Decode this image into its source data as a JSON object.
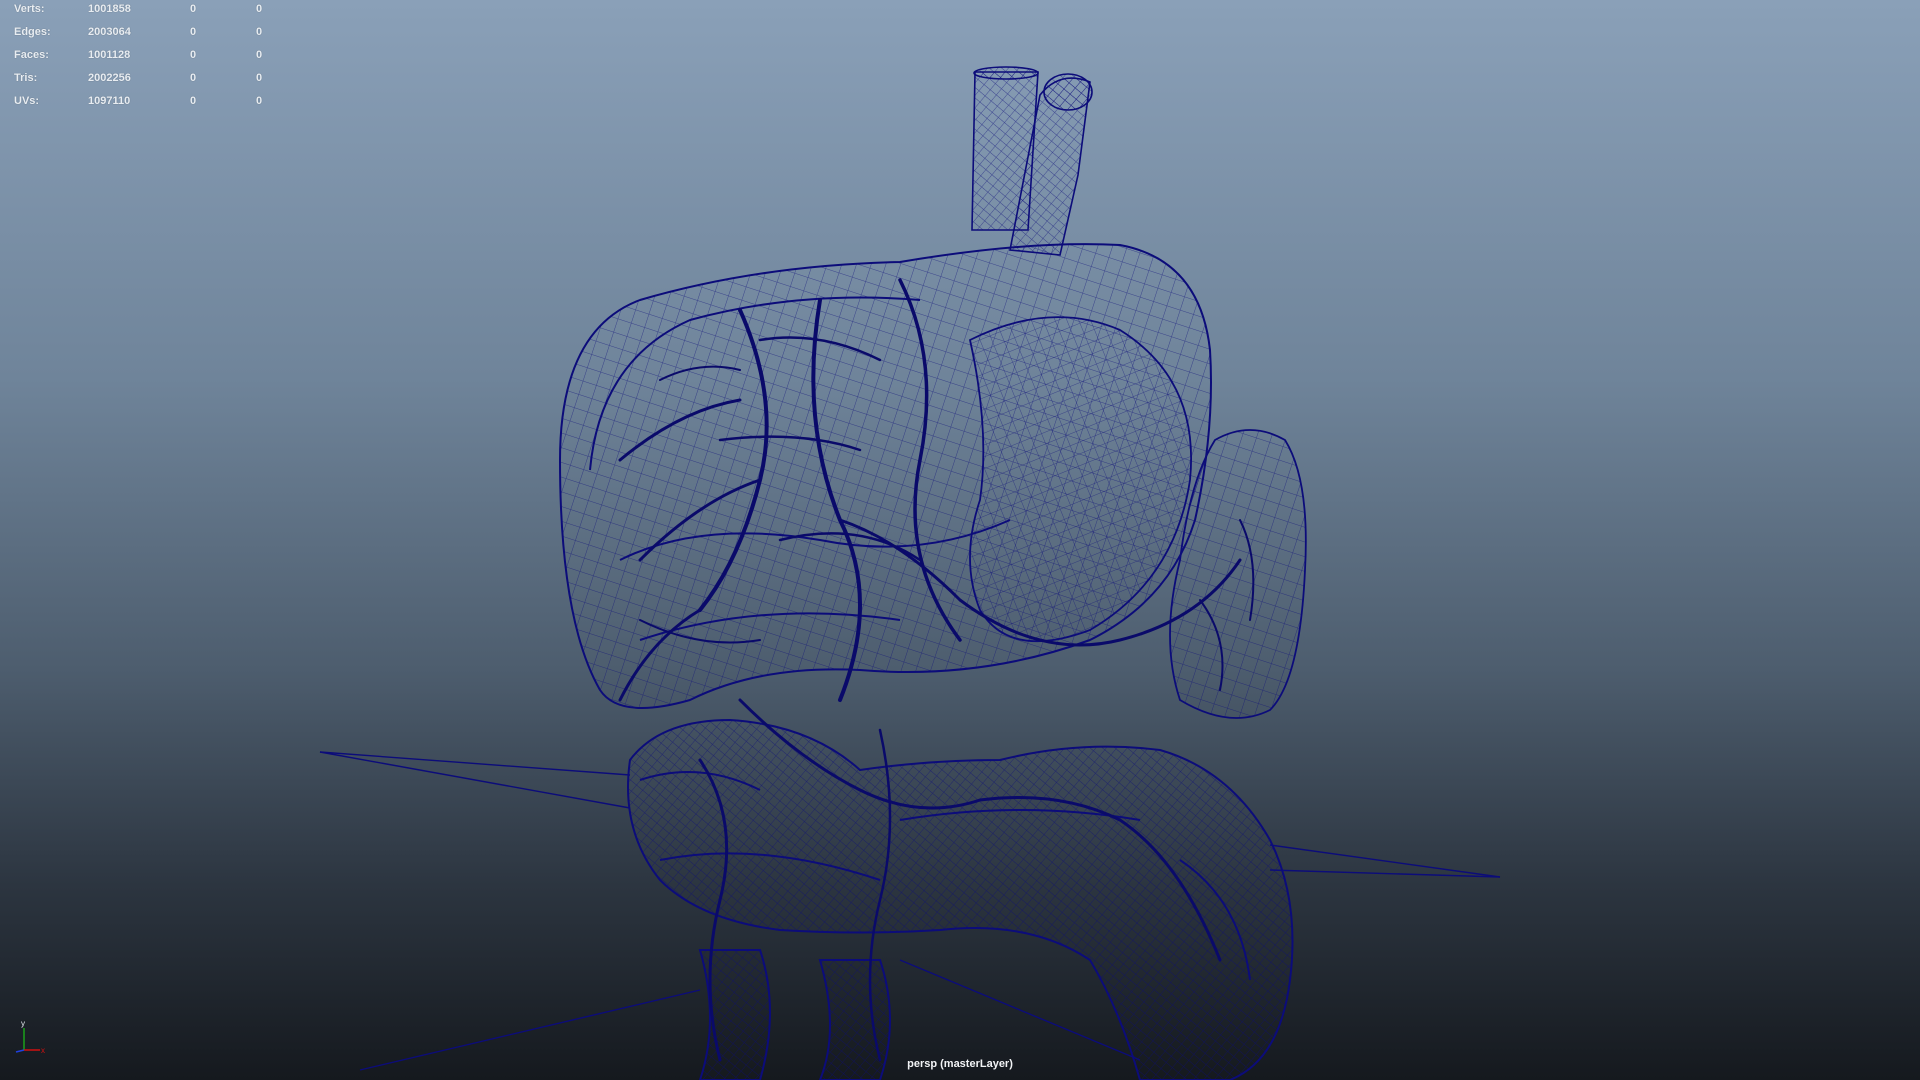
{
  "viewport": {
    "camera_label": "persp (masterLayer)",
    "wire_color": "#0c0c7a",
    "background_top": "#8aa0b8",
    "background_bottom": "#15191e"
  },
  "hud": {
    "rows": [
      {
        "label": "Verts:",
        "v1": "1001858",
        "v2": "0",
        "v3": "0"
      },
      {
        "label": "Edges:",
        "v1": "2003064",
        "v2": "0",
        "v3": "0"
      },
      {
        "label": "Faces:",
        "v1": "1001128",
        "v2": "0",
        "v3": "0"
      },
      {
        "label": "Tris:",
        "v1": "2002256",
        "v2": "0",
        "v3": "0"
      },
      {
        "label": "UVs:",
        "v1": "1097110",
        "v2": "0",
        "v3": "0"
      }
    ]
  },
  "axis_gizmo": {
    "y_label": "y",
    "x_label": "x",
    "colors": {
      "x": "#d01010",
      "y": "#1aa01a",
      "z": "#2040e0"
    }
  }
}
